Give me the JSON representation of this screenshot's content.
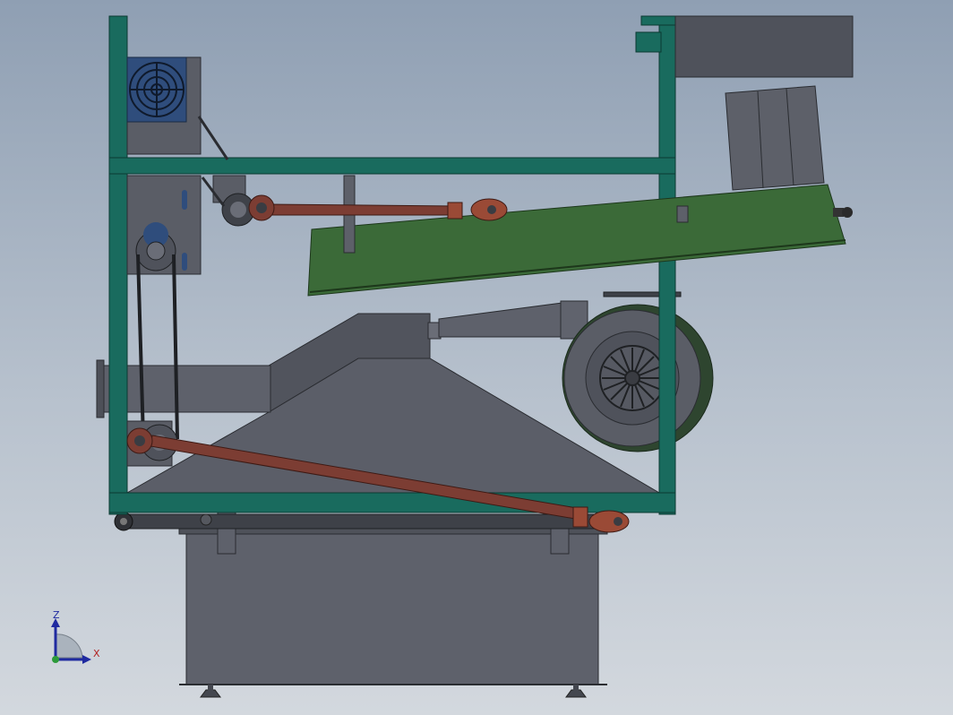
{
  "triad": {
    "z_label": "Z",
    "x_label": "X"
  },
  "colors": {
    "frame": "#196b5e",
    "metal": "#5d5f69",
    "metal_dark": "#40434b",
    "trough": "#3b6a38",
    "rod": "#7c3d33",
    "rod_end": "#9a4a36",
    "fan_housing": "#2f4731",
    "motor": "#2f4d7c"
  },
  "icons": {
    "triad": "coordinate-triad-icon",
    "motor_fan": "fan-grille-icon"
  }
}
